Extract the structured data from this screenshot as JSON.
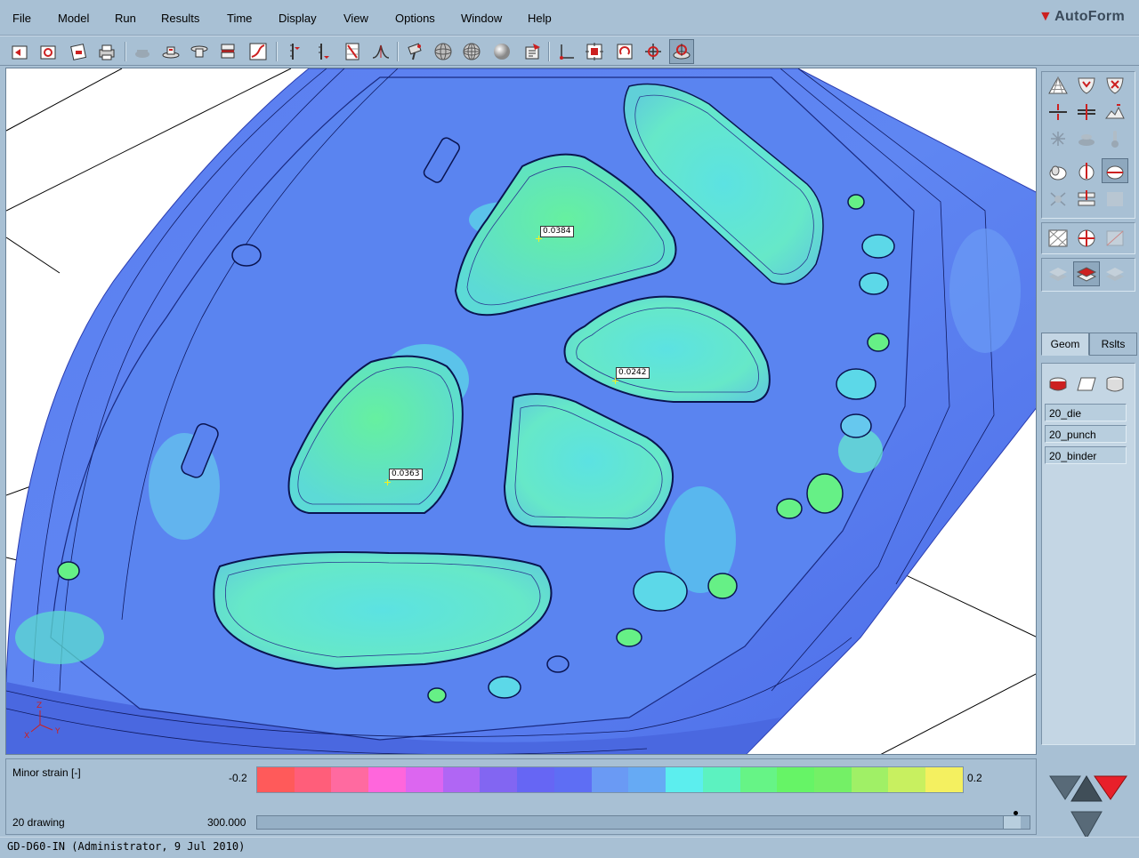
{
  "menu": {
    "items": [
      {
        "label": "File"
      },
      {
        "label": "Model"
      },
      {
        "label": "Run"
      },
      {
        "label": "Results"
      },
      {
        "label": "Time"
      },
      {
        "label": "Display"
      },
      {
        "label": "View"
      },
      {
        "label": "Options"
      },
      {
        "label": "Window"
      },
      {
        "label": "Help"
      }
    ],
    "logo": "AutoForm"
  },
  "toolbar": {
    "icons": [
      "open-file-icon",
      "save-file-icon",
      "print-preview-icon",
      "print-icon",
      "tool-disabled-icon",
      "punch-icon",
      "die-icon",
      "blank-holder-icon",
      "curve-icon",
      "section-ruler-icon",
      "height-ruler-icon",
      "grid-ruler-icon",
      "gaussian-icon",
      "paint-icon",
      "wire-sphere-icon",
      "mesh-sphere-icon",
      "shaded-sphere-icon",
      "clipboard-icon",
      "axes-icon",
      "fit-view-icon",
      "rotate-view-icon",
      "pan-view-icon",
      "zoom-view-icon"
    ]
  },
  "viewport": {
    "labels": [
      {
        "text": "0.0384"
      },
      {
        "text": "0.0242"
      },
      {
        "text": "0.0363"
      }
    ],
    "axes": {
      "z": "Z",
      "x": "X",
      "y": "Y"
    }
  },
  "right_panel": {
    "tabs": [
      {
        "label": "Geom"
      },
      {
        "label": "Rslts"
      }
    ],
    "active_tab": "Geom",
    "tools": [
      {
        "label": "20_die"
      },
      {
        "label": "20_punch"
      },
      {
        "label": "20_binder"
      }
    ]
  },
  "bottom": {
    "variable": "Minor strain [-]",
    "min": "-0.2",
    "max": "0.2",
    "operation": "20 drawing",
    "time_value": "300.000",
    "scale_colors": [
      "#ff5a5a",
      "#ff5e7a",
      "#ff6aa0",
      "#ff66dc",
      "#dc66f0",
      "#b066f4",
      "#8266f2",
      "#6666f4",
      "#5e6ef4",
      "#6a9af4",
      "#66aaf4",
      "#5ceeee",
      "#5cf2c0",
      "#66f486",
      "#66f466",
      "#74f066",
      "#a0f066",
      "#c8f060",
      "#f4f060"
    ]
  },
  "status": {
    "text": "GD-D60-IN (Administrator,  9 Jul 2010)"
  }
}
